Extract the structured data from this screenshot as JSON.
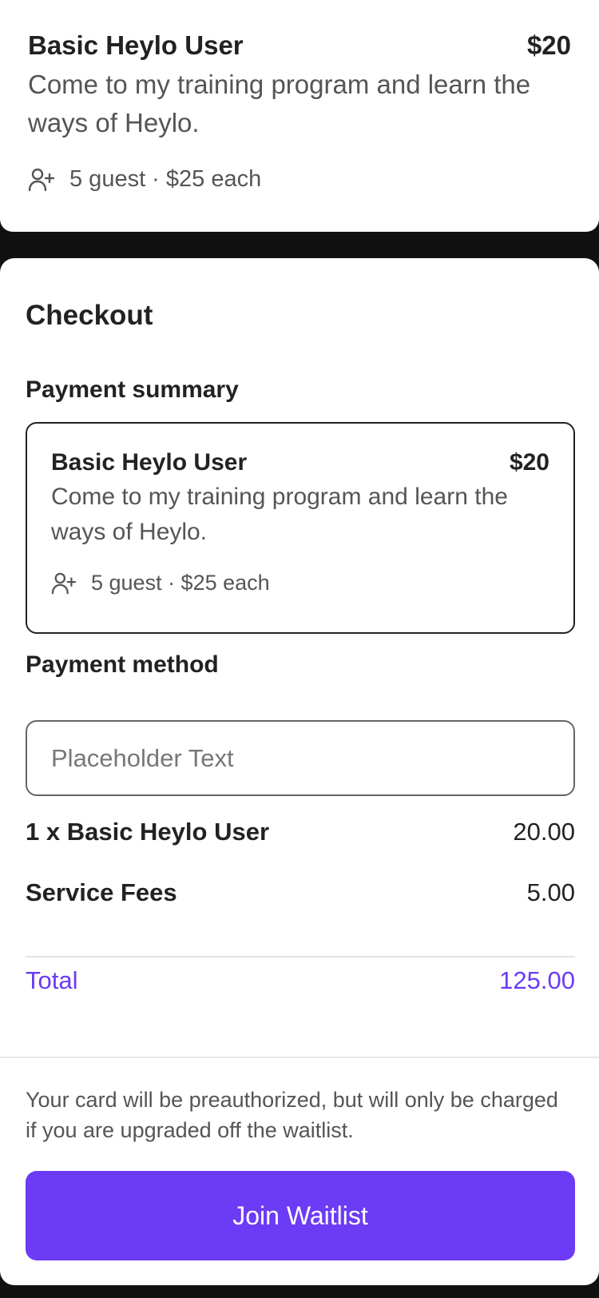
{
  "top_card": {
    "title": "Basic Heylo User",
    "price": "$20",
    "description": "Come to my training program and learn the ways of Heylo.",
    "guest_info": "5 guest · $25 each"
  },
  "checkout": {
    "title": "Checkout",
    "payment_summary_label": "Payment summary",
    "summary": {
      "title": "Basic Heylo User",
      "price": "$20",
      "description": "Come to my training program and learn the ways of Heylo.",
      "guest_info": "5 guest · $25 each"
    },
    "payment_method_label": "Payment method",
    "payment_method_placeholder": "Placeholder Text",
    "line_items": [
      {
        "label": "1 x Basic Heylo User",
        "value": "20.00"
      },
      {
        "label": "Service Fees",
        "value": "5.00"
      }
    ],
    "total": {
      "label": "Total",
      "value": "125.00"
    },
    "note": "Your card will be preauthorized, but will only be charged if you are upgraded off the waitlist.",
    "cta_label": "Join Waitlist"
  },
  "colors": {
    "accent": "#6c3bf5",
    "background": "#111111"
  }
}
